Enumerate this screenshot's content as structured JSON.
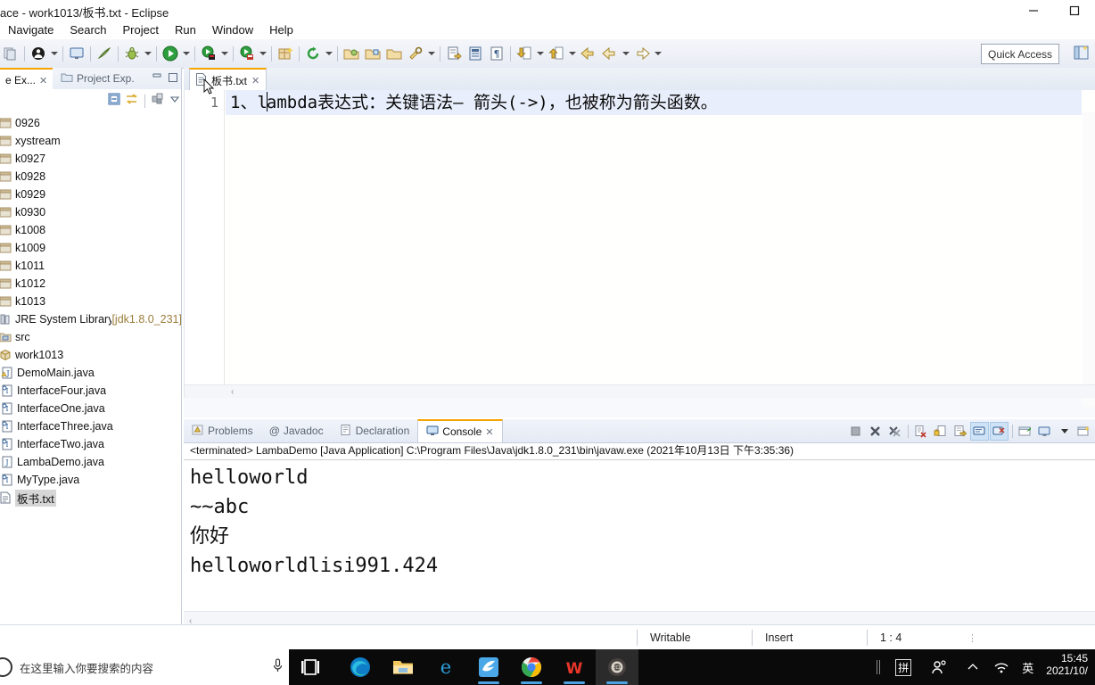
{
  "window": {
    "title": "ace - work1013/板书.txt - Eclipse",
    "minimize_label": "Minimize",
    "maximize_label": "Maximize"
  },
  "menubar": {
    "items": [
      {
        "label": "Navigate"
      },
      {
        "label": "Search"
      },
      {
        "label": "Project"
      },
      {
        "label": "Run"
      },
      {
        "label": "Window"
      },
      {
        "label": "Help"
      }
    ]
  },
  "toolbar": {
    "quick_access": "Quick Access",
    "icons": [
      "save-all-icon",
      "new-java-class-icon",
      "console-view-icon",
      "skip-breakpoints-icon",
      "debug-icon",
      "run-icon",
      "run-external-tools-icon",
      "run-last-tool-icon",
      "new-package-icon",
      "refresh-icon",
      "open-type-icon",
      "open-task-icon",
      "search-icon",
      "next-annotation-icon",
      "previous-annotation-icon",
      "back-icon",
      "forward-icon"
    ]
  },
  "left_panel": {
    "tabs": [
      {
        "label": "e Ex...",
        "active": true,
        "icon": "package-explorer-icon"
      },
      {
        "label": "Project Exp.",
        "active": false,
        "icon": "project-explorer-icon"
      }
    ],
    "view_toolbar": [
      "collapse-all-icon",
      "link-with-editor-icon",
      "view-menu-icon",
      "chevron-down-icon"
    ],
    "tree": [
      {
        "label": "0926",
        "icon": "project-icon",
        "twisty": "",
        "indent": 0
      },
      {
        "label": "xystream",
        "icon": "project-icon",
        "twisty": "",
        "indent": 0
      },
      {
        "label": "k0927",
        "icon": "project-icon",
        "twisty": "",
        "indent": 0
      },
      {
        "label": "k0928",
        "icon": "project-icon",
        "twisty": "",
        "indent": 0
      },
      {
        "label": "k0929",
        "icon": "project-icon",
        "twisty": "",
        "indent": 0
      },
      {
        "label": "k0930",
        "icon": "project-icon",
        "twisty": "",
        "indent": 0
      },
      {
        "label": "k1008",
        "icon": "project-icon",
        "twisty": "",
        "indent": 0
      },
      {
        "label": "k1009",
        "icon": "project-icon",
        "twisty": "",
        "indent": 0
      },
      {
        "label": "k1011",
        "icon": "project-icon",
        "twisty": "",
        "indent": 0
      },
      {
        "label": "k1012",
        "icon": "project-icon",
        "twisty": "",
        "indent": 0
      },
      {
        "label": "k1013",
        "icon": "project-icon",
        "twisty": "",
        "indent": 0
      },
      {
        "label": "JRE System Library",
        "suffix": " [jdk1.8.0_231]",
        "icon": "library-icon",
        "twisty": "",
        "indent": 0
      },
      {
        "label": "src",
        "icon": "source-folder-icon",
        "twisty": "",
        "indent": 0
      },
      {
        "label": "work1013",
        "icon": "package-icon",
        "twisty": "",
        "indent": 0
      },
      {
        "label": "DemoMain.java",
        "icon": "java-file-warning-icon",
        "twisty": "›",
        "indent": 1
      },
      {
        "label": "InterfaceFour.java",
        "icon": "java-interface-icon",
        "twisty": "›",
        "indent": 1
      },
      {
        "label": "InterfaceOne.java",
        "icon": "java-interface-icon",
        "twisty": "›",
        "indent": 1
      },
      {
        "label": "InterfaceThree.java",
        "icon": "java-interface-icon",
        "twisty": "›",
        "indent": 1
      },
      {
        "label": "InterfaceTwo.java",
        "icon": "java-interface-icon",
        "twisty": "›",
        "indent": 1
      },
      {
        "label": "LambaDemo.java",
        "icon": "java-file-icon",
        "twisty": "›",
        "indent": 1
      },
      {
        "label": "MyType.java",
        "icon": "java-interface-icon",
        "twisty": "›",
        "indent": 1
      },
      {
        "label": "板书.txt",
        "icon": "text-file-icon",
        "twisty": "",
        "indent": 0,
        "selected": true
      }
    ]
  },
  "editor": {
    "tab": {
      "label": "板书.txt",
      "icon": "text-file-icon",
      "close": "✕"
    },
    "line_number": "1",
    "line_text_before_caret": "1、l",
    "line_text_after_caret": "ambda表达式：关键语法— 箭头(->)，也被称为箭头函数。"
  },
  "console_panel": {
    "tabs": [
      {
        "label": "Problems",
        "icon": "problems-icon",
        "active": false
      },
      {
        "label": "Javadoc",
        "icon": "javadoc-icon",
        "active": false
      },
      {
        "label": "Declaration",
        "icon": "declaration-icon",
        "active": false
      },
      {
        "label": "Console",
        "icon": "console-icon",
        "active": true,
        "close": "✕"
      }
    ],
    "tools": [
      "terminate-icon",
      "remove-launch-icon",
      "remove-all-terminated-icon",
      "clear-console-icon",
      "scroll-lock-icon",
      "word-wrap-icon",
      "show-console-on-output-icon",
      "show-console-on-error-icon",
      "pin-console-icon",
      "display-selected-console-icon",
      "chevron-down-icon",
      "open-console-icon"
    ],
    "header": "<terminated> LambaDemo [Java Application] C:\\Program Files\\Java\\jdk1.8.0_231\\bin\\javaw.exe (2021年10月13日 下午3:35:36)",
    "output": [
      "helloworld",
      "~~abc",
      "你好",
      "helloworldlisi991.424"
    ]
  },
  "statusbar": {
    "writable": "Writable",
    "insert_mode": "Insert",
    "position": "1 : 4"
  },
  "taskbar": {
    "search_placeholder": "在这里输入你要搜索的内容",
    "apps": [
      {
        "name": "task-view-icon"
      },
      {
        "name": "microsoft-edge-icon"
      },
      {
        "name": "file-explorer-icon"
      },
      {
        "name": "internet-explorer-icon"
      },
      {
        "name": "bird-app-icon"
      },
      {
        "name": "google-chrome-icon"
      },
      {
        "name": "wps-office-icon"
      },
      {
        "name": "eclipse-icon"
      }
    ],
    "ime_label": "拼",
    "lang_label": "英",
    "time": "15:45",
    "date": "2021/10/"
  },
  "colors": {
    "accent_tab": "#f6a400",
    "active_line": "#e8eefb",
    "toolbar_bg": "#eef1f7",
    "taskbar_bg": "#0a0a0a"
  }
}
